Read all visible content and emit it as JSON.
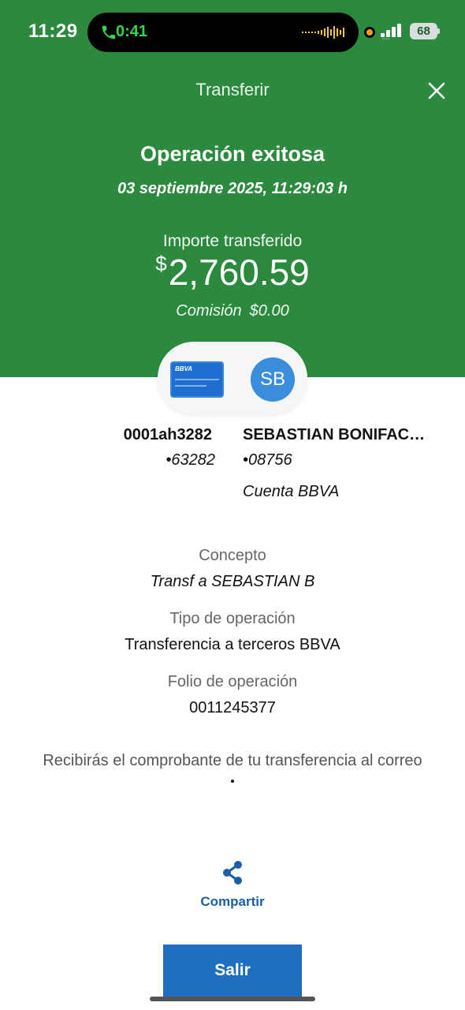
{
  "status_bar": {
    "time": "11:29",
    "call_timer": "0:41",
    "battery": "68",
    "call_color": "#33d74b"
  },
  "header": {
    "title": "Transferir",
    "close_icon": "close-icon",
    "background": "#2b8a3e"
  },
  "result": {
    "title": "Operación exitosa",
    "datetime": "03 septiembre 2025, 11:29:03 h",
    "amount_label": "Importe transferido",
    "currency_symbol": "$",
    "amount": "2,760.59",
    "commission_label": "Comisión",
    "commission_value": "$0.00"
  },
  "accounts": {
    "card_brand": "BBVA",
    "avatar_initials": "SB",
    "from": {
      "name": "0001ah3282",
      "number": "•63282"
    },
    "to": {
      "name": "SEBASTIAN BONIFAC…",
      "number": "•08756",
      "type": "Cuenta BBVA"
    }
  },
  "details": {
    "concept_label": "Concepto",
    "concept_value": "Transf a SEBASTIAN B",
    "operation_type_label": "Tipo de operación",
    "operation_type_value": "Transferencia a terceros BBVA",
    "folio_label": "Folio de operación",
    "folio_value": "0011245377"
  },
  "notice": "Recibirás el comprobante de tu transferencia al correo",
  "actions": {
    "share_label": "Compartir",
    "share_icon": "share-icon",
    "exit_label": "Salir",
    "primary_color": "#1f6fc0"
  }
}
